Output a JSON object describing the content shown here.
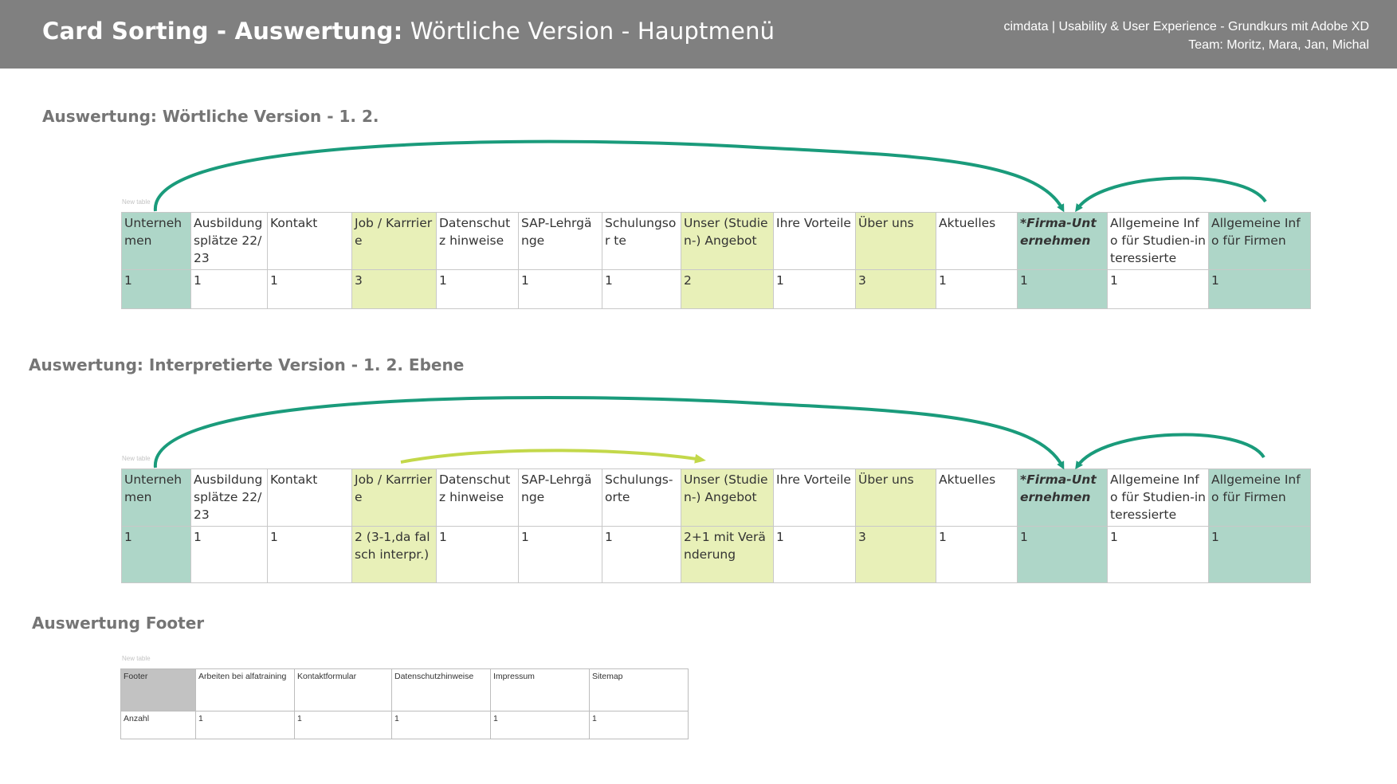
{
  "header": {
    "title_bold": "Card Sorting - Auswertung:",
    "title_light": "Wörtliche Version - Hauptmenü",
    "meta_line1": "cimdata | Usability & User Experience - Grundkurs mit Adobe XD",
    "meta_line2": "Team: Moritz, Mara, Jan, Michal"
  },
  "sections": {
    "literal_title": "Auswertung: Wörtliche Version - 1. 2.",
    "interpreted_title": "Auswertung: Interpretierte Version - 1. 2. Ebene",
    "footer_title": "Auswertung Footer"
  },
  "new_table_label": "New table",
  "colors": {
    "teal": "#aed6c8",
    "lime": "#e8f0b8",
    "gray": "#c2c2c2",
    "arrow_teal": "#1a9b7b",
    "arrow_lime": "#c3d84a"
  },
  "literal_table": {
    "headers": [
      "Unterneh men",
      "Ausbildung splätze 22/23",
      "Kontakt",
      "Job / Karrriere",
      "Datenschutz hinweise",
      "SAP-Lehrgänge",
      "Schulungsor te",
      "Unser (Studien-) Angebot",
      "Ihre Vorteile",
      "Über uns",
      "Aktuelles",
      "*Firma-Unternehmen",
      "Allgemeine Info für Studien-interessierte",
      "Allgemeine Info für Firmen"
    ],
    "values": [
      "1",
      "1",
      "1",
      "3",
      "1",
      "1",
      "1",
      "2",
      "1",
      "3",
      "1",
      "1",
      "1",
      "1"
    ]
  },
  "interpreted_table": {
    "headers": [
      "Unterneh men",
      "Ausbildung splätze 22/23",
      "Kontakt",
      "Job / Karrriere",
      "Datenschutz hinweise",
      "SAP-Lehrgänge",
      "Schulungs-orte",
      "Unser (Studien-) Angebot",
      "Ihre Vorteile",
      "Über uns",
      "Aktuelles",
      "*Firma-Unternehmen",
      "Allgemeine Info für Studien-interessierte",
      "Allgemeine Info für Firmen"
    ],
    "values": [
      "1",
      "1",
      "1",
      "2 (3-1,da falsch interpr.)",
      "1",
      "1",
      "1",
      "2+1 mit Veränderung",
      "1",
      "3",
      "1",
      "1",
      "1",
      "1"
    ]
  },
  "footer_table": {
    "headers": [
      "Footer",
      "Arbeiten bei alfatraining",
      "Kontaktformular",
      "Datenschutzhinweise",
      "Impressum",
      "Sitemap"
    ],
    "values": [
      "Anzahl",
      "1",
      "1",
      "1",
      "1",
      "1"
    ]
  }
}
